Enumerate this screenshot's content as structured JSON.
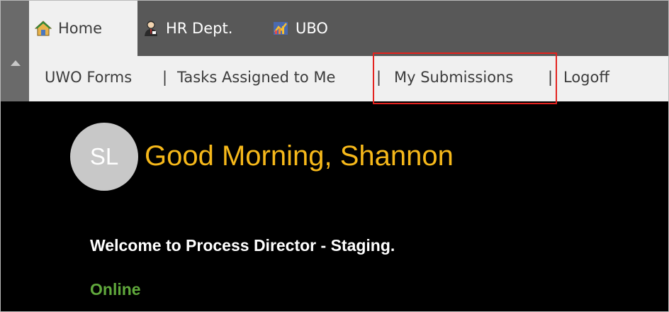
{
  "tabs": [
    {
      "label": "Home",
      "icon": "home-icon",
      "active": true
    },
    {
      "label": "HR Dept.",
      "icon": "hr-person-icon",
      "active": false
    },
    {
      "label": "UBO",
      "icon": "ubo-chart-icon",
      "active": false
    }
  ],
  "subnav": {
    "items": [
      "UWO Forms",
      "Tasks Assigned to Me",
      "My Submissions",
      "Logoff"
    ],
    "separator": "|",
    "highlighted_item": "My Submissions"
  },
  "user": {
    "initials": "SL",
    "greeting": "Good Morning, Shannon"
  },
  "welcome_message": "Welcome to Process Director - Staging.",
  "status": "Online",
  "colors": {
    "greeting": "#f6b81a",
    "status": "#60a83c",
    "highlight": "#e3231f",
    "tab_active_bg": "#f0f0f0",
    "tab_bar_bg": "#585858",
    "content_bg": "#000000"
  }
}
